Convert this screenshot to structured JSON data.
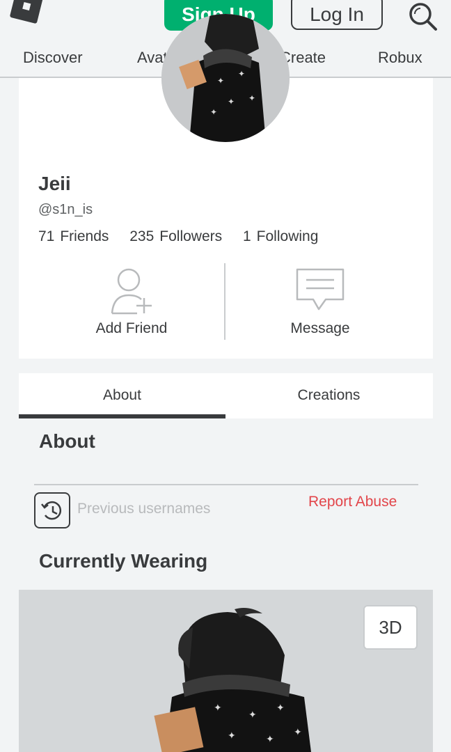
{
  "header": {
    "signup_label": "Sign Up",
    "login_label": "Log In",
    "logo_icon": "roblox-logo",
    "search_icon": "search-icon"
  },
  "nav": {
    "items": [
      {
        "label": "Discover"
      },
      {
        "label": "Avatar Shop"
      },
      {
        "label": "Create"
      },
      {
        "label": "Robux"
      }
    ]
  },
  "profile": {
    "display_name": "Jeii",
    "username": "@s1n_is",
    "stats": {
      "friends_count": "71",
      "friends_label": "Friends",
      "followers_count": "235",
      "followers_label": "Followers",
      "following_count": "1",
      "following_label": "Following"
    },
    "actions": {
      "add_friend_label": "Add Friend",
      "message_label": "Message"
    }
  },
  "tabs": [
    {
      "label": "About",
      "active": true
    },
    {
      "label": "Creations",
      "active": false
    }
  ],
  "about": {
    "heading": "About",
    "previous_usernames_label": "Previous usernames",
    "report_abuse_label": "Report Abuse"
  },
  "wearing": {
    "heading": "Currently Wearing",
    "toggle_3d_label": "3D"
  },
  "colors": {
    "accent_green": "#00b06f",
    "report_red": "#e2454a",
    "text_dark": "#393b3d",
    "page_bg": "#f2f4f5"
  }
}
